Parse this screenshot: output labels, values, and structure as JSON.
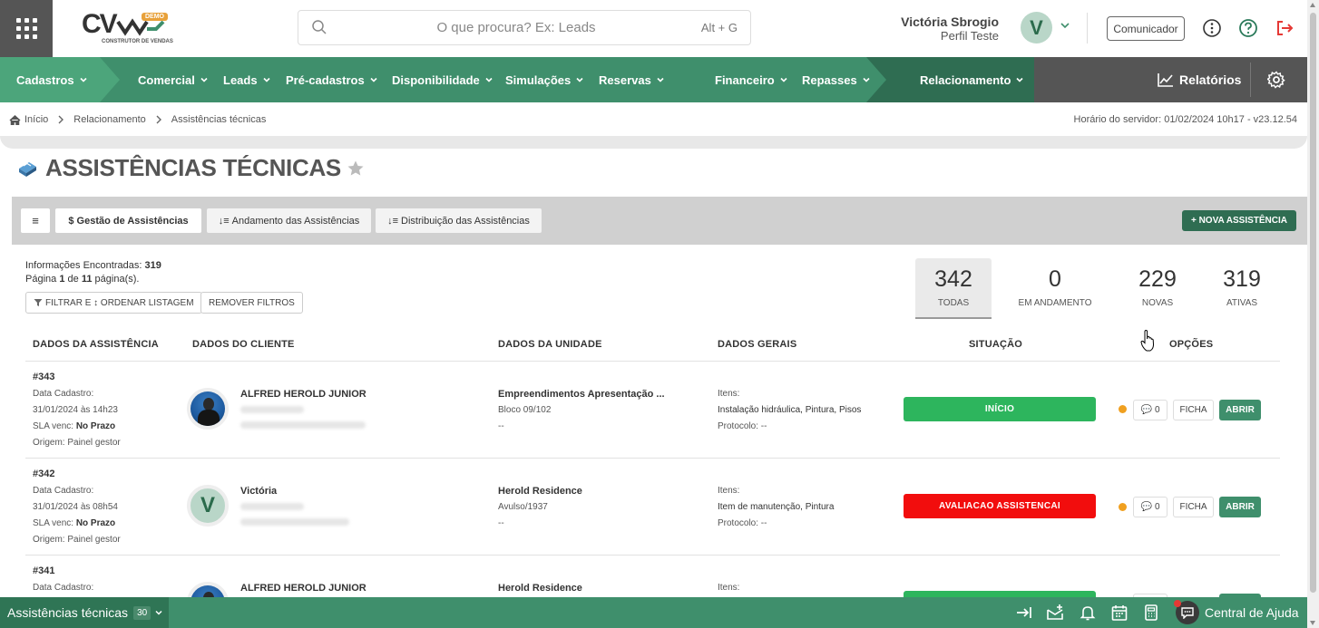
{
  "header": {
    "logo_text": "CV",
    "logo_badge": "DEMO",
    "logo_subtitle": "CONSTRUTOR DE VENDAS",
    "search_placeholder": "O que procura? Ex: Leads",
    "search_shortcut": "Alt + G",
    "user_name": "Victória Sbrogio",
    "user_profile": "Perfil Teste",
    "avatar_initial": "V",
    "comunicador_label": "Comunicador"
  },
  "nav": {
    "items": [
      {
        "label": "Cadastros"
      },
      {
        "label": "Comercial"
      },
      {
        "label": "Leads"
      },
      {
        "label": "Pré-cadastros"
      },
      {
        "label": "Disponibilidade"
      },
      {
        "label": "Simulações"
      },
      {
        "label": "Reservas"
      },
      {
        "label": "Financeiro"
      },
      {
        "label": "Repasses"
      },
      {
        "label": "Relacionamento"
      }
    ],
    "reports_label": "Relatórios"
  },
  "breadcrumb": {
    "home": "Início",
    "section": "Relacionamento",
    "page": "Assistências técnicas"
  },
  "server_time": "Horário do servidor: 01/02/2024 10h17 - v23.12.54",
  "page_title": "ASSISTÊNCIAS TÉCNICAS",
  "tabs": [
    {
      "label": "$ Gestão de Assistências"
    },
    {
      "label": "Andamento das Assistências"
    },
    {
      "label": "Distribuição das Assistências"
    }
  ],
  "new_button": "+ NOVA ASSISTÊNCIA",
  "info": {
    "found_label": "Informações Encontradas:",
    "found_count": "319",
    "page_prefix": "Página",
    "page_current": "1",
    "page_of": "de",
    "page_total": "11",
    "page_suffix": "página(s)."
  },
  "filters": {
    "filter_label": "FILTRAR E ↕ ORDENAR LISTAGEM",
    "remove_label": "REMOVER FILTROS"
  },
  "stats": [
    {
      "value": "342",
      "label": "TODAS"
    },
    {
      "value": "0",
      "label": "EM ANDAMENTO"
    },
    {
      "value": "229",
      "label": "NOVAS"
    },
    {
      "value": "319",
      "label": "ATIVAS"
    }
  ],
  "columns": [
    "DADOS DA ASSISTÊNCIA",
    "DADOS DO CLIENTE",
    "DADOS DA UNIDADE",
    "DADOS GERAIS",
    "SITUAÇÃO",
    "OPÇÕES"
  ],
  "rows": [
    {
      "id": "#343",
      "cad_label": "Data Cadastro:",
      "cad_date": "31/01/2024 às 14h23",
      "sla_label": "SLA venc:",
      "sla_value": "No Prazo",
      "origin": "Origem: Painel gestor",
      "client_name": "ALFRED HEROLD JUNIOR",
      "unit_name": "Empreendimentos Apresentação ...",
      "unit_block": "Bloco 09/102",
      "unit_extra": "--",
      "items_label": "Itens:",
      "items": "Instalação hidráulica, Pintura, Pisos",
      "protocol": "Protocolo: --",
      "status": "INÍCIO",
      "status_color": "#2db55d",
      "comments": "0",
      "ficha": "FICHA",
      "abrir": "ABRIR"
    },
    {
      "id": "#342",
      "cad_label": "Data Cadastro:",
      "cad_date": "31/01/2024 às 08h54",
      "sla_label": "SLA venc:",
      "sla_value": "No Prazo",
      "origin": "Origem: Painel gestor",
      "client_name": "Victória",
      "client_initial": "V",
      "unit_name": "Herold Residence",
      "unit_block": "Avulso/1937",
      "unit_extra": "--",
      "items_label": "Itens:",
      "items": "Item de manutenção, Pintura",
      "protocol": "Protocolo: --",
      "status": "AVALIACAO ASSISTENCAI",
      "status_color": "#f20d0d",
      "comments": "0",
      "ficha": "FICHA",
      "abrir": "ABRIR"
    },
    {
      "id": "#341",
      "cad_label": "Data Cadastro:",
      "client_name": "ALFRED HEROLD JUNIOR",
      "unit_name": "Herold Residence",
      "items_label": "Itens:"
    }
  ],
  "bottom": {
    "module_label": "Assistências técnicas",
    "count": "30",
    "help_label": "Central de Ajuda"
  },
  "colors": {
    "nav_green": "#3f8f6c",
    "dark_green": "#2f6d52",
    "status_green": "#2db55d",
    "status_red": "#f20d0d"
  }
}
